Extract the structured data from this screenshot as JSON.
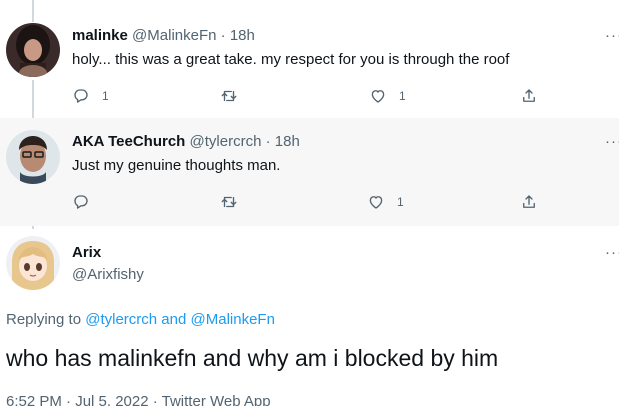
{
  "replies": [
    {
      "display_name": "malinke",
      "handle": "@MalinkeFn",
      "separator": "·",
      "time": "18h",
      "text": "holy... this was a great take. my respect for you is through the roof",
      "more": "···",
      "reply_count": "1",
      "retweet_count": "",
      "like_count": "1"
    },
    {
      "display_name": "AKA TeeChurch",
      "handle": "@tylercrch",
      "separator": "·",
      "time": "18h",
      "text": "Just my genuine thoughts man.",
      "more": "···",
      "reply_count": "",
      "retweet_count": "",
      "like_count": "1"
    }
  ],
  "main_tweet": {
    "display_name": "Arix",
    "handle": "@Arixfishy",
    "more": "···",
    "replying_prefix": "Replying to",
    "replying_to_1": "@tylercrch",
    "replying_and": "and",
    "replying_to_2": "@MalinkeFn",
    "text": "who has malinkefn and why am i blocked by him",
    "meta": "6:52 PM · Jul 5, 2022 · Twitter Web App"
  },
  "colors": {
    "text": "#0f1419",
    "secondary": "#536471",
    "link": "#1d9bf0",
    "highlight_bg": "#f7f7f7",
    "thread_line": "#cfd9de"
  }
}
